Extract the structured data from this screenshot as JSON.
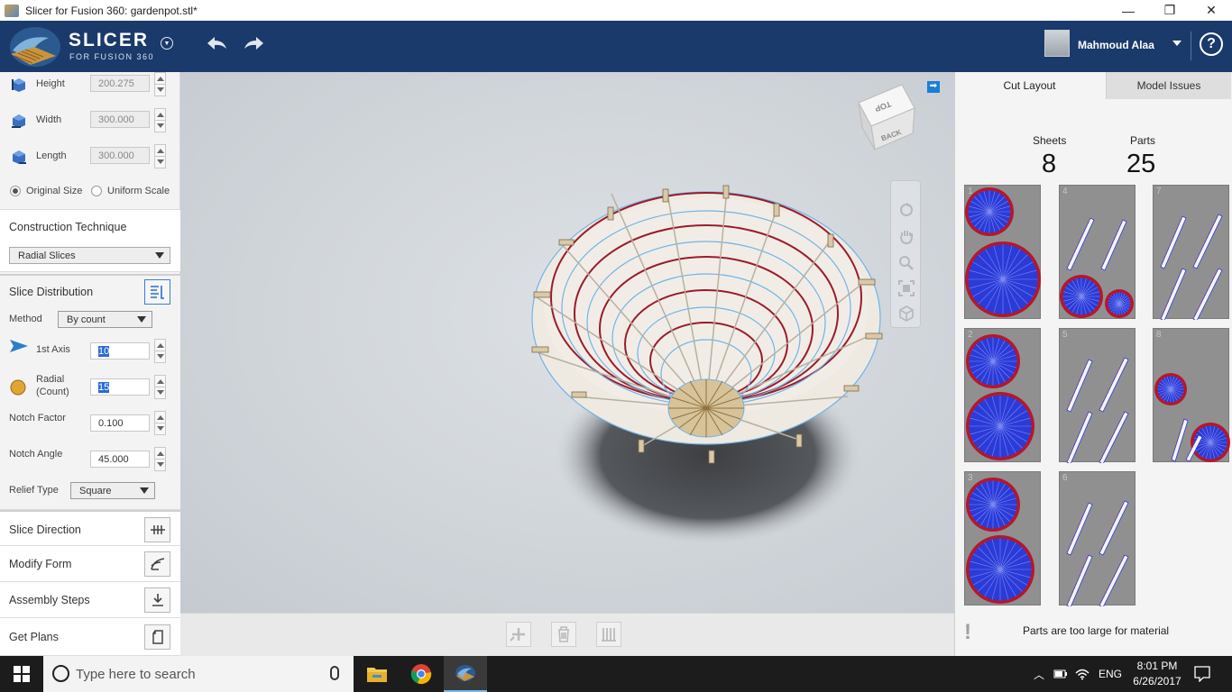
{
  "window": {
    "title": "Slicer for Fusion 360: gardenpot.stl*",
    "min": "—",
    "max": "❐",
    "close": "✕"
  },
  "header": {
    "logo_title": "SLICER",
    "logo_sub": "FOR FUSION 360",
    "user_name": "Mahmoud Alaa",
    "help": "?"
  },
  "dimensions": {
    "height_label": "Height",
    "height_value": "200.275",
    "width_label": "Width",
    "width_value": "300.000",
    "length_label": "Length",
    "length_value": "300.000",
    "original_size": "Original Size",
    "uniform_scale": "Uniform Scale"
  },
  "construction": {
    "title": "Construction Technique",
    "value": "Radial Slices"
  },
  "distribution": {
    "title": "Slice Distribution",
    "method_label": "Method",
    "method_value": "By count",
    "axis1_label": "1st Axis",
    "axis1_value": "10",
    "radial_label": "Radial",
    "radial_label2": "(Count)",
    "radial_value": "15",
    "notch_factor_label": "Notch Factor",
    "notch_factor_value": "0.100",
    "notch_angle_label": "Notch Angle",
    "notch_angle_value": "45.000",
    "relief_label": "Relief Type",
    "relief_value": "Square"
  },
  "sections": [
    "Slice Direction",
    "Modify Form",
    "Assembly Steps",
    "Get Plans"
  ],
  "viewcube": {
    "top": "TOP",
    "back": "BACK"
  },
  "right_panel": {
    "tab_cut_layout": "Cut Layout",
    "tab_model_issues": "Model Issues",
    "sheets_label": "Sheets",
    "sheets_value": "8",
    "parts_label": "Parts",
    "parts_value": "25",
    "sheet_numbers": [
      "1",
      "4",
      "7",
      "2",
      "5",
      "8",
      "3",
      "6"
    ],
    "warning_icon": "!",
    "warning_text": "Parts are too large for material"
  },
  "taskbar": {
    "search_placeholder": "Type here to search",
    "lang": "ENG",
    "time": "8:01 PM",
    "date": "6/26/2017"
  },
  "colors": {
    "header": "#1a3a6b",
    "accent_blue": "#1a7fd4",
    "sheet_gray": "#909090",
    "ring_red": "#b5172a",
    "ring_blue": "#2a3bd8"
  }
}
